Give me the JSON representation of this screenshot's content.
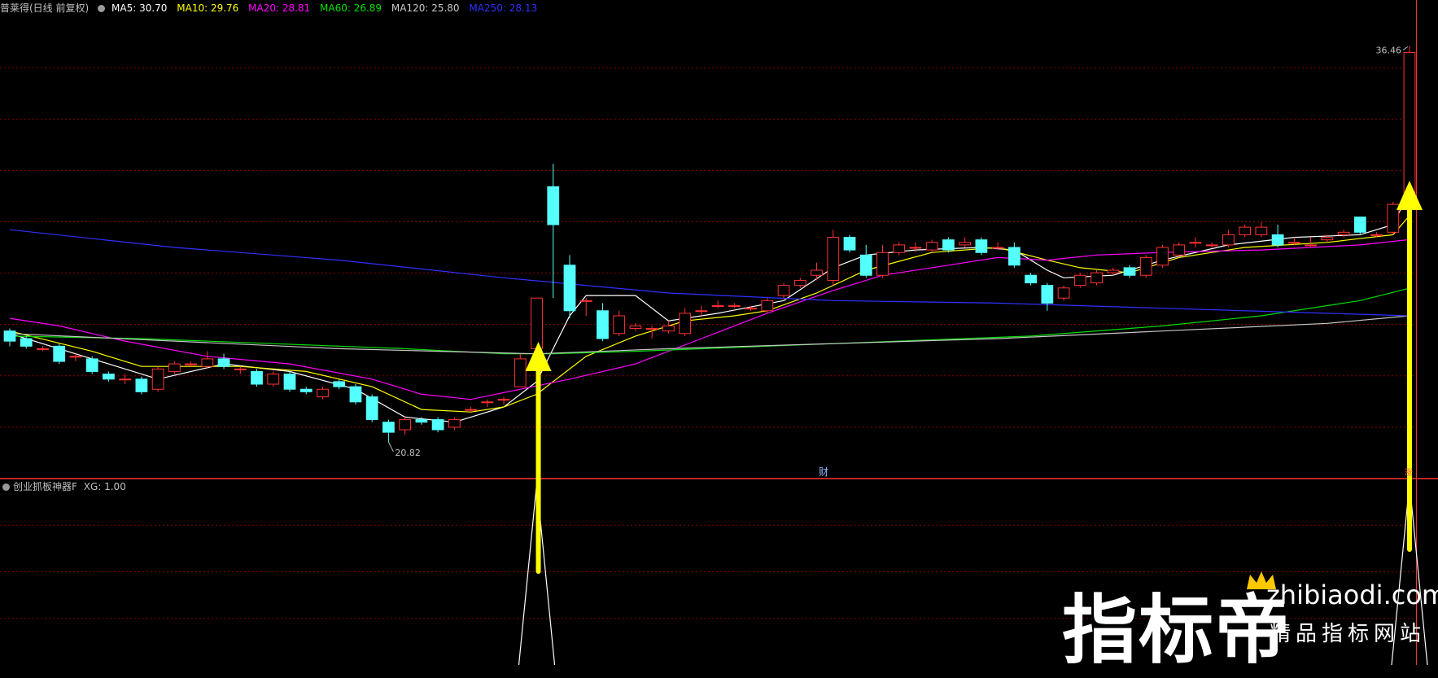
{
  "header": {
    "title": "普莱得(日线 前复权)",
    "ma": [
      {
        "label": "MA5: 30.70",
        "color": "#ffffff"
      },
      {
        "label": "MA10: 29.76",
        "color": "#ffff00"
      },
      {
        "label": "MA20: 28.81",
        "color": "#ff00ff"
      },
      {
        "label": "MA60: 26.89",
        "color": "#00e000"
      },
      {
        "label": "MA120: 25.80",
        "color": "#c8c8c8"
      },
      {
        "label": "MA250: 28.13",
        "color": "#3030ff"
      }
    ]
  },
  "indicator": {
    "title": "创业抓板神器F",
    "value_label": "XG: 1.00"
  },
  "watermark": {
    "logo": "指标帝",
    "url": "zhibiaodi.com",
    "slogan": "精品指标网站"
  },
  "colors": {
    "up": "#ff3232",
    "down": "#54ffff",
    "grid": "#8a0000",
    "arrow": "#ffff00",
    "axis": "#ff3232"
  },
  "chart_data": {
    "type": "candlestick",
    "y_range": [
      19.5,
      37.5
    ],
    "high_label": "36.46",
    "low_label": "20.82",
    "finance_marker": "财",
    "end_marker": "涨",
    "candles": [
      [
        25.2,
        24.8,
        25.3,
        24.6
      ],
      [
        24.9,
        24.6,
        25.0,
        24.5
      ],
      [
        24.5,
        24.5,
        24.6,
        24.4
      ],
      [
        24.6,
        24.0,
        24.7,
        23.9
      ],
      [
        24.2,
        24.2,
        24.3,
        24.0
      ],
      [
        24.1,
        23.6,
        24.2,
        23.5
      ],
      [
        23.5,
        23.3,
        23.6,
        23.2
      ],
      [
        23.3,
        23.3,
        23.5,
        23.1
      ],
      [
        23.3,
        22.8,
        23.4,
        22.7
      ],
      [
        22.9,
        23.7,
        23.8,
        22.8
      ],
      [
        23.6,
        23.9,
        24.0,
        23.5
      ],
      [
        23.9,
        23.9,
        24.0,
        23.8
      ],
      [
        23.8,
        24.1,
        24.4,
        23.7
      ],
      [
        24.1,
        23.8,
        24.3,
        23.7
      ],
      [
        23.7,
        23.7,
        23.8,
        23.5
      ],
      [
        23.6,
        23.1,
        23.7,
        23.0
      ],
      [
        23.1,
        23.5,
        23.6,
        23.0
      ],
      [
        23.5,
        22.9,
        23.6,
        22.8
      ],
      [
        22.9,
        22.8,
        23.0,
        22.7
      ],
      [
        22.6,
        22.9,
        23.0,
        22.5
      ],
      [
        23.2,
        23.0,
        23.3,
        22.9
      ],
      [
        23.0,
        22.4,
        23.1,
        22.3
      ],
      [
        22.6,
        21.7,
        22.7,
        21.6
      ],
      [
        21.6,
        21.2,
        21.7,
        20.82
      ],
      [
        21.3,
        21.7,
        21.8,
        21.1
      ],
      [
        21.7,
        21.6,
        21.8,
        21.5
      ],
      [
        21.7,
        21.3,
        21.8,
        21.2
      ],
      [
        21.4,
        21.7,
        21.8,
        21.3
      ],
      [
        22.1,
        22.1,
        22.2,
        22.0
      ],
      [
        22.4,
        22.4,
        22.5,
        22.2
      ],
      [
        22.5,
        22.5,
        22.6,
        22.3
      ],
      [
        23.0,
        24.1,
        24.3,
        23.0
      ],
      [
        24.5,
        26.5,
        26.5,
        24.4
      ],
      [
        30.9,
        29.4,
        31.8,
        26.5
      ],
      [
        27.8,
        26.0,
        28.2,
        25.7
      ],
      [
        26.4,
        26.4,
        26.5,
        25.8
      ],
      [
        26.0,
        24.9,
        26.3,
        24.8
      ],
      [
        25.1,
        25.8,
        26.0,
        25.0
      ],
      [
        25.3,
        25.4,
        25.5,
        25.2
      ],
      [
        25.3,
        25.3,
        25.4,
        24.9
      ],
      [
        25.2,
        25.4,
        25.6,
        25.1
      ],
      [
        25.1,
        25.9,
        26.1,
        25.0
      ],
      [
        26.0,
        26.0,
        26.2,
        25.8
      ],
      [
        26.2,
        26.2,
        26.4,
        26.1
      ],
      [
        26.2,
        26.2,
        26.3,
        26.1
      ],
      [
        26.1,
        26.1,
        26.2,
        26.0
      ],
      [
        26.0,
        26.4,
        26.5,
        25.9
      ],
      [
        26.6,
        27.0,
        27.1,
        26.5
      ],
      [
        27.0,
        27.2,
        27.3,
        26.9
      ],
      [
        27.4,
        27.6,
        27.9,
        27.2
      ],
      [
        27.2,
        28.9,
        29.2,
        27.0
      ],
      [
        28.9,
        28.4,
        29.0,
        28.3
      ],
      [
        28.2,
        27.4,
        28.6,
        27.3
      ],
      [
        27.4,
        28.3,
        28.6,
        27.3
      ],
      [
        28.3,
        28.6,
        28.7,
        28.2
      ],
      [
        28.5,
        28.5,
        28.7,
        28.3
      ],
      [
        28.4,
        28.7,
        28.8,
        28.3
      ],
      [
        28.8,
        28.4,
        28.9,
        28.3
      ],
      [
        28.6,
        28.7,
        28.9,
        28.5
      ],
      [
        28.8,
        28.3,
        28.9,
        28.2
      ],
      [
        28.5,
        28.5,
        28.7,
        28.4
      ],
      [
        28.5,
        27.8,
        28.7,
        27.7
      ],
      [
        27.4,
        27.1,
        27.5,
        27.0
      ],
      [
        27.0,
        26.3,
        27.1,
        26.0
      ],
      [
        26.5,
        26.9,
        27.0,
        26.4
      ],
      [
        27.0,
        27.4,
        27.5,
        26.9
      ],
      [
        27.1,
        27.5,
        27.6,
        27.0
      ],
      [
        27.5,
        27.6,
        27.7,
        27.4
      ],
      [
        27.7,
        27.4,
        27.8,
        27.3
      ],
      [
        27.4,
        28.1,
        28.2,
        27.3
      ],
      [
        27.8,
        28.5,
        28.6,
        27.7
      ],
      [
        28.2,
        28.6,
        28.7,
        28.1
      ],
      [
        28.7,
        28.7,
        28.9,
        28.5
      ],
      [
        28.6,
        28.6,
        28.7,
        28.5
      ],
      [
        28.6,
        29.0,
        29.2,
        28.5
      ],
      [
        29.0,
        29.3,
        29.4,
        28.9
      ],
      [
        29.0,
        29.3,
        29.5,
        28.9
      ],
      [
        29.0,
        28.6,
        29.4,
        28.5
      ],
      [
        28.7,
        28.7,
        28.9,
        28.6
      ],
      [
        28.6,
        28.6,
        28.9,
        28.5
      ],
      [
        28.8,
        28.9,
        29.0,
        28.7
      ],
      [
        29.0,
        29.1,
        29.2,
        28.9
      ],
      [
        29.7,
        29.1,
        29.7,
        29.0
      ],
      [
        29.0,
        29.0,
        29.1,
        28.9
      ],
      [
        29.1,
        30.2,
        30.3,
        29.0
      ],
      [
        30.0,
        36.2,
        36.46,
        29.9
      ]
    ],
    "ma": {
      "MA5": [
        [
          0,
          25.1
        ],
        [
          6,
          23.9
        ],
        [
          9,
          23.3
        ],
        [
          13,
          23.9
        ],
        [
          17,
          23.6
        ],
        [
          21,
          22.9
        ],
        [
          24,
          21.8
        ],
        [
          27,
          21.6
        ],
        [
          30,
          22.2
        ],
        [
          32,
          23.2
        ],
        [
          34,
          25.8
        ],
        [
          35,
          26.6
        ],
        [
          38,
          26.6
        ],
        [
          40,
          25.6
        ],
        [
          43,
          25.9
        ],
        [
          47,
          26.4
        ],
        [
          50,
          27.7
        ],
        [
          52,
          28.2
        ],
        [
          55,
          28.4
        ],
        [
          59,
          28.5
        ],
        [
          61,
          28.4
        ],
        [
          63,
          27.6
        ],
        [
          64,
          27.3
        ],
        [
          67,
          27.4
        ],
        [
          70,
          28.0
        ],
        [
          74,
          28.6
        ],
        [
          78,
          28.9
        ],
        [
          82,
          29.0
        ],
        [
          84,
          29.4
        ],
        [
          85,
          30.7
        ]
      ],
      "MA10": [
        [
          0,
          25.2
        ],
        [
          5,
          24.4
        ],
        [
          8,
          23.8
        ],
        [
          14,
          23.8
        ],
        [
          18,
          23.6
        ],
        [
          22,
          23.0
        ],
        [
          25,
          22.1
        ],
        [
          28,
          22.0
        ],
        [
          30,
          22.2
        ],
        [
          32,
          22.7
        ],
        [
          35,
          24.2
        ],
        [
          38,
          25.0
        ],
        [
          41,
          25.6
        ],
        [
          44,
          25.8
        ],
        [
          46,
          26.0
        ],
        [
          49,
          26.7
        ],
        [
          52,
          27.6
        ],
        [
          56,
          28.3
        ],
        [
          60,
          28.5
        ],
        [
          63,
          28.0
        ],
        [
          65,
          27.7
        ],
        [
          68,
          27.5
        ],
        [
          71,
          28.1
        ],
        [
          75,
          28.5
        ],
        [
          80,
          28.7
        ],
        [
          84,
          29.0
        ],
        [
          85,
          29.76
        ]
      ],
      "MA20": [
        [
          0,
          25.7
        ],
        [
          3,
          25.4
        ],
        [
          7,
          24.8
        ],
        [
          12,
          24.2
        ],
        [
          17,
          23.9
        ],
        [
          22,
          23.3
        ],
        [
          25,
          22.7
        ],
        [
          28,
          22.5
        ],
        [
          31,
          22.9
        ],
        [
          34,
          23.3
        ],
        [
          38,
          23.9
        ],
        [
          42,
          24.9
        ],
        [
          46,
          25.9
        ],
        [
          50,
          26.8
        ],
        [
          53,
          27.4
        ],
        [
          57,
          27.8
        ],
        [
          60,
          28.1
        ],
        [
          63,
          28.0
        ],
        [
          66,
          28.2
        ],
        [
          70,
          28.3
        ],
        [
          76,
          28.4
        ],
        [
          82,
          28.6
        ],
        [
          85,
          28.81
        ]
      ],
      "MA60": [
        [
          0,
          25.0
        ],
        [
          8,
          24.9
        ],
        [
          16,
          24.7
        ],
        [
          24,
          24.5
        ],
        [
          30,
          24.3
        ],
        [
          33,
          24.3
        ],
        [
          38,
          24.4
        ],
        [
          46,
          24.6
        ],
        [
          54,
          24.8
        ],
        [
          62,
          25.0
        ],
        [
          70,
          25.4
        ],
        [
          76,
          25.8
        ],
        [
          82,
          26.4
        ],
        [
          85,
          26.89
        ]
      ],
      "MA120": [
        [
          0,
          25.1
        ],
        [
          20,
          24.5
        ],
        [
          32,
          24.3
        ],
        [
          40,
          24.5
        ],
        [
          50,
          24.7
        ],
        [
          60,
          24.9
        ],
        [
          70,
          25.2
        ],
        [
          80,
          25.5
        ],
        [
          85,
          25.8
        ]
      ],
      "MA250": [
        [
          0,
          29.2
        ],
        [
          10,
          28.5
        ],
        [
          20,
          28.0
        ],
        [
          30,
          27.3
        ],
        [
          40,
          26.7
        ],
        [
          50,
          26.4
        ],
        [
          60,
          26.3
        ],
        [
          70,
          26.1
        ],
        [
          80,
          25.9
        ],
        [
          85,
          25.8
        ]
      ]
    },
    "xg_signals": [
      32,
      85
    ],
    "xg_range": [
      0,
      1
    ]
  }
}
